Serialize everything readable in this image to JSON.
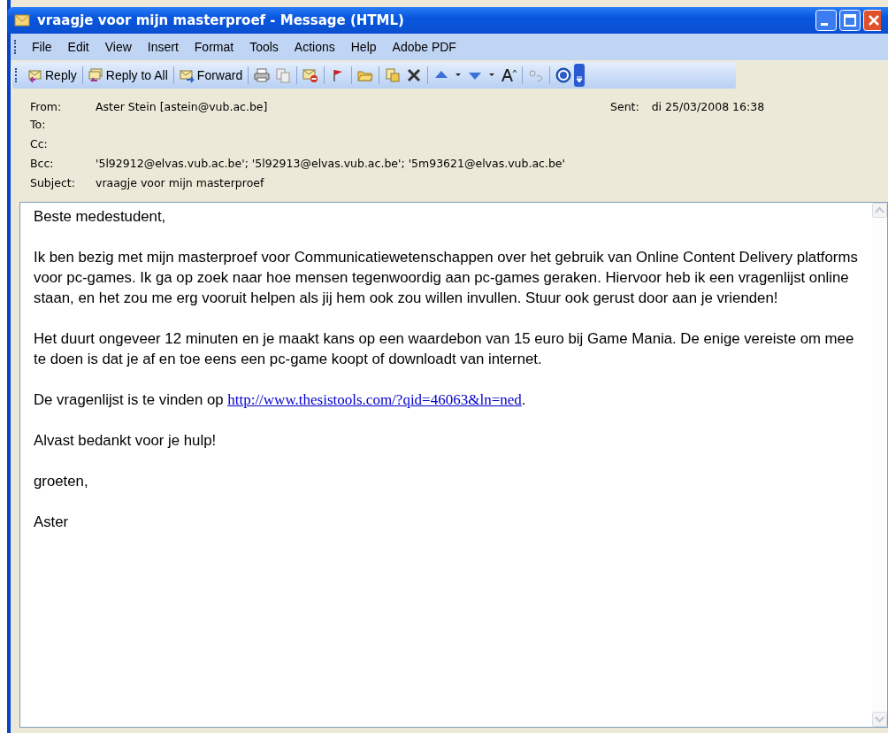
{
  "window": {
    "title": "vraagje voor mijn masterproef - Message (HTML)"
  },
  "menu": [
    "File",
    "Edit",
    "View",
    "Insert",
    "Format",
    "Tools",
    "Actions",
    "Help",
    "Adobe PDF"
  ],
  "toolbar": {
    "buttons": [
      {
        "label": "Reply"
      },
      {
        "label": "Reply to All"
      },
      {
        "label": "Forward"
      }
    ]
  },
  "header": {
    "from": {
      "label": "From:",
      "value": "Aster Stein [astein@vub.ac.be]"
    },
    "sent": {
      "label": "Sent:",
      "value": "di 25/03/2008 16:38"
    },
    "fields": [
      {
        "label": "To:"
      },
      {
        "label": "Cc:"
      },
      {
        "label": "Bcc:",
        "value": "'5l92912@elvas.vub.ac.be'; '5l92913@elvas.vub.ac.be'; '5m93621@elvas.vub.ac.be'"
      },
      {
        "label": "Subject:",
        "value": "vraagje voor mijn masterproef"
      }
    ]
  },
  "body": [
    {
      "text": "Beste medestudent,"
    },
    {
      "text": "Ik ben bezig met mijn masterproef voor Communicatiewetenschappen over het gebruik van Online Content Delivery platforms voor pc-games. Ik ga op zoek naar hoe mensen tegenwoordig aan pc-games geraken. Hiervoor heb ik een vragenlijst online staan, en het zou me erg vooruit helpen als jij hem ook zou willen invullen. Stuur ook gerust door aan je vrienden!"
    },
    {
      "text": "Het duurt ongeveer 12 minuten en je maakt kans op een waardebon van 15 euro bij Game Mania. De enige vereiste om mee te doen is dat je af en toe eens een pc-game koopt of downloadt van internet."
    },
    {
      "text": "De vragenlijst is te vinden op ",
      "link": "http://www.thesistools.com/?qid=46063&ln=ned",
      "after": "."
    },
    {
      "text": "Alvast bedankt voor je hulp!"
    },
    {
      "text": "groeten,"
    },
    {
      "text": "Aster"
    }
  ]
}
